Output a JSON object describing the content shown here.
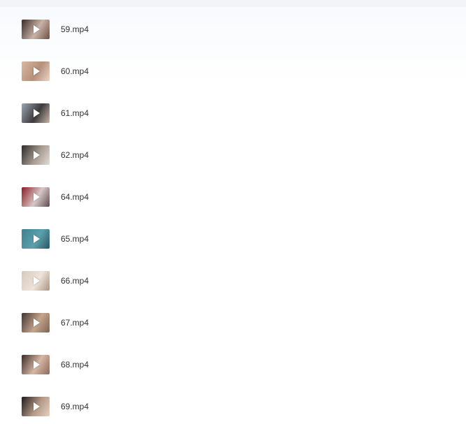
{
  "files": [
    {
      "name": "59.mp4",
      "thumb_colors": [
        "#3a2c28",
        "#c9b2a6",
        "#6d5047"
      ],
      "icon": "play-icon"
    },
    {
      "name": "60.mp4",
      "thumb_colors": [
        "#d9b8a3",
        "#b58f7a",
        "#ead6c8"
      ],
      "icon": "play-icon"
    },
    {
      "name": "61.mp4",
      "thumb_colors": [
        "#9aa7b3",
        "#3d3a3b",
        "#c8b7ab"
      ],
      "icon": "play-icon"
    },
    {
      "name": "62.mp4",
      "thumb_colors": [
        "#2c2a2b",
        "#a89c92",
        "#e3dcd6"
      ],
      "icon": "play-icon"
    },
    {
      "name": "64.mp4",
      "thumb_colors": [
        "#8c1d25",
        "#d8c8c6",
        "#5e4a52"
      ],
      "icon": "play-icon"
    },
    {
      "name": "65.mp4",
      "thumb_colors": [
        "#3f7f8f",
        "#5ba1ad",
        "#2d5563"
      ],
      "icon": "play-icon"
    },
    {
      "name": "66.mp4",
      "thumb_colors": [
        "#d6c8bd",
        "#efe4da",
        "#a89483"
      ],
      "icon": "play-icon"
    },
    {
      "name": "67.mp4",
      "thumb_colors": [
        "#403330",
        "#c6a58d",
        "#7b6458"
      ],
      "icon": "play-icon"
    },
    {
      "name": "68.mp4",
      "thumb_colors": [
        "#3b2b27",
        "#d6b8a6",
        "#8a6a5d"
      ],
      "icon": "play-icon"
    },
    {
      "name": "69.mp4",
      "thumb_colors": [
        "#1f1a1a",
        "#b59a86",
        "#e4d1c3"
      ],
      "icon": "play-icon"
    }
  ]
}
